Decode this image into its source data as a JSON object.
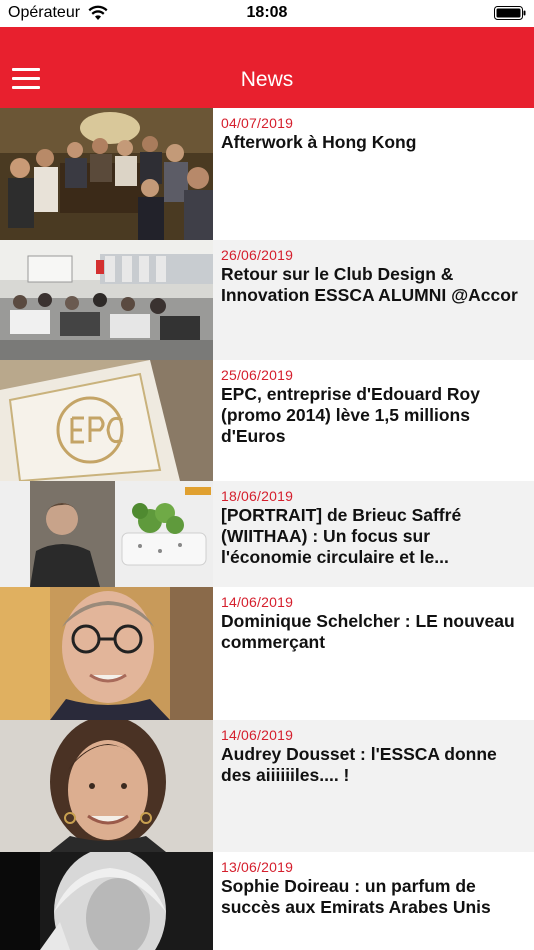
{
  "status_bar": {
    "carrier": "Opérateur",
    "time": "18:08"
  },
  "nav": {
    "title": "News",
    "menu_icon": "hamburger-menu-icon",
    "accent_color": "#e8202e"
  },
  "news": [
    {
      "date": "04/07/2019",
      "title": "Afterwork à Hong Kong",
      "image": "group-photo-restaurant"
    },
    {
      "date": "26/06/2019",
      "title": "Retour sur le Club Design & Innovation ESSCA ALUMNI @Accor",
      "image": "conference-audience"
    },
    {
      "date": "25/06/2019",
      "title": "EPC, entreprise d'Edouard Roy (promo 2014) lève 1,5 millions d'Euros",
      "image": "champagne-bottle-label"
    },
    {
      "date": "18/06/2019",
      "title": "[PORTRAIT] de Brieuc Saffré (WIITHAA) : Un focus sur l'économie circulaire et le...",
      "image": "man-and-planter"
    },
    {
      "date": "14/06/2019",
      "title": "Dominique Schelcher : LE nouveau commerçant",
      "image": "man-with-glasses-portrait"
    },
    {
      "date": "14/06/2019",
      "title": "Audrey Dousset : l'ESSCA donne des aiiiiiiles.... !",
      "image": "woman-portrait"
    },
    {
      "date": "13/06/2019",
      "title": "Sophie Doireau : un parfum de succès aux Emirats Arabes Unis",
      "image": "woman-bw-portrait"
    }
  ]
}
